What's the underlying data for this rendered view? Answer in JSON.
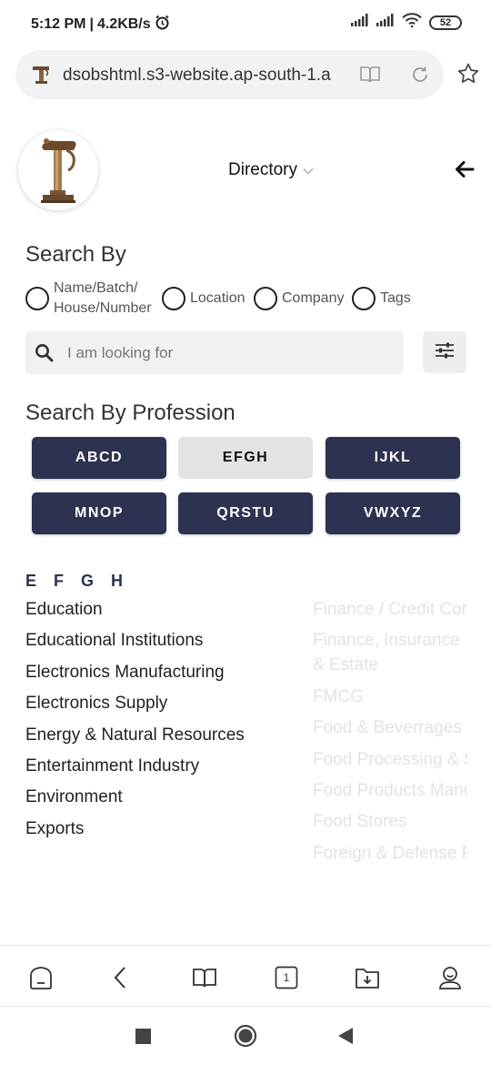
{
  "status_bar": {
    "time": "5:12 PM",
    "net_speed": "4.2KB/s",
    "battery": "52",
    "icons": [
      "alarm-icon",
      "signal-icon",
      "signal-icon",
      "wifi-icon",
      "battery-icon"
    ]
  },
  "browser": {
    "url": "dsobshtml.s3-website.ap-south-1.a",
    "icons": [
      "site-favicon",
      "reader-mode-icon",
      "reload-icon",
      "star-icon"
    ]
  },
  "header": {
    "title": "Directory"
  },
  "search": {
    "title": "Search By",
    "options": [
      {
        "label_line1": "Name/Batch/",
        "label_line2": "House/Number"
      },
      {
        "label": "Location"
      },
      {
        "label": "Company"
      },
      {
        "label": "Tags"
      }
    ],
    "placeholder": "I am looking for"
  },
  "profession": {
    "title": "Search By Profession",
    "buttons": [
      "ABCD",
      "EFGH",
      "IJKL",
      "MNOP",
      "QRSTU",
      "VWXYZ"
    ],
    "active": "EFGH"
  },
  "listing": {
    "heading": "E F G H",
    "left": [
      "Education",
      "Educational Institutions",
      "Electronics Manufacturing",
      "Electronics Supply",
      "Energy & Natural Resources",
      "Entertainment Industry",
      "Environment",
      "Exports"
    ],
    "right": [
      "Finance / Credit Cor",
      "Finance, Insurance & Estate",
      "FMCG",
      "Food & Beverrages",
      "Food Processing & S",
      "Food Products Manu",
      "Food Stores",
      "Foreign & Defense P"
    ]
  },
  "bottom_toolbar": {
    "tab_count": "1",
    "icons": [
      "home-icon",
      "back-icon",
      "bookmarks-icon",
      "tabs-icon",
      "downloads-icon",
      "profile-icon"
    ]
  },
  "colors": {
    "navy": "#2c3250",
    "active_button": "#e3e3e3",
    "faded_text": "#e3e3e3"
  }
}
